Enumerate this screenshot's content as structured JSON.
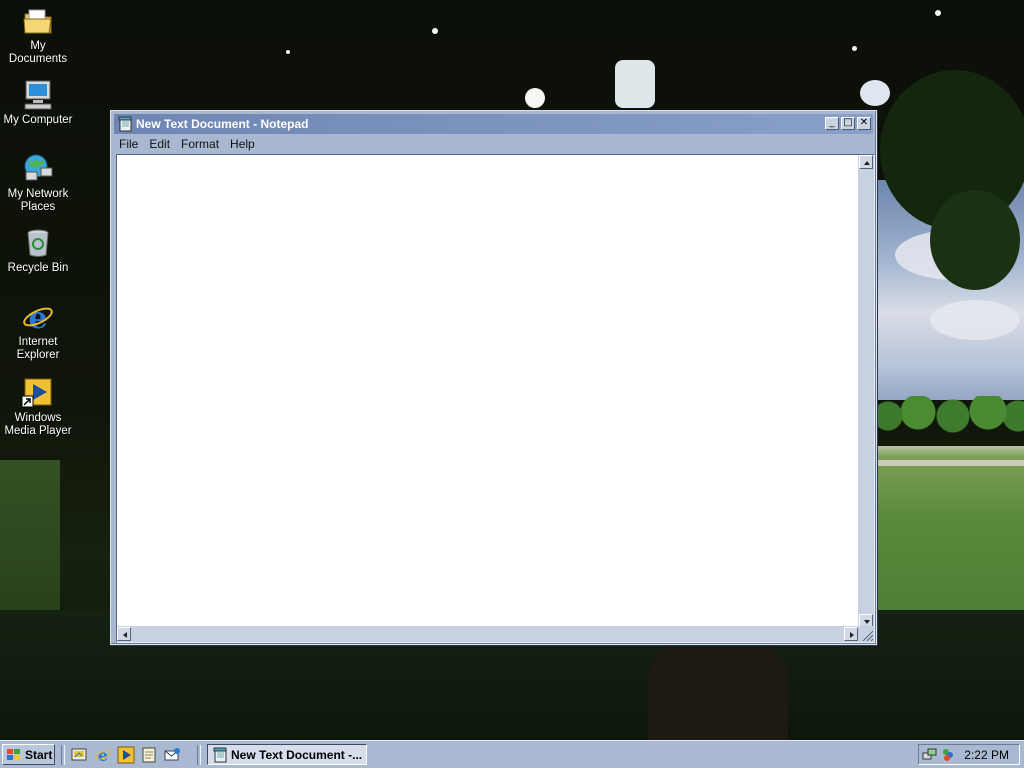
{
  "desktop": {
    "icons": [
      {
        "label": "My Documents"
      },
      {
        "label": "My Computer"
      },
      {
        "label": "My Network Places"
      },
      {
        "label": "Recycle Bin"
      },
      {
        "label": "Internet Explorer"
      },
      {
        "label": "Windows Media Player"
      }
    ]
  },
  "window": {
    "title": "New Text Document - Notepad",
    "controls": {
      "minimize": "_",
      "maximize": "□",
      "close": "✕"
    },
    "menu": [
      "File",
      "Edit",
      "Format",
      "Help"
    ],
    "content": ""
  },
  "taskbar": {
    "start_label": "Start",
    "task_label": "New Text Document -...",
    "clock": "2:22 PM"
  },
  "colors": {
    "title_bar": "#7a91bd",
    "window_face": "#a8b8d0",
    "taskbar": "#a8b9d1"
  }
}
